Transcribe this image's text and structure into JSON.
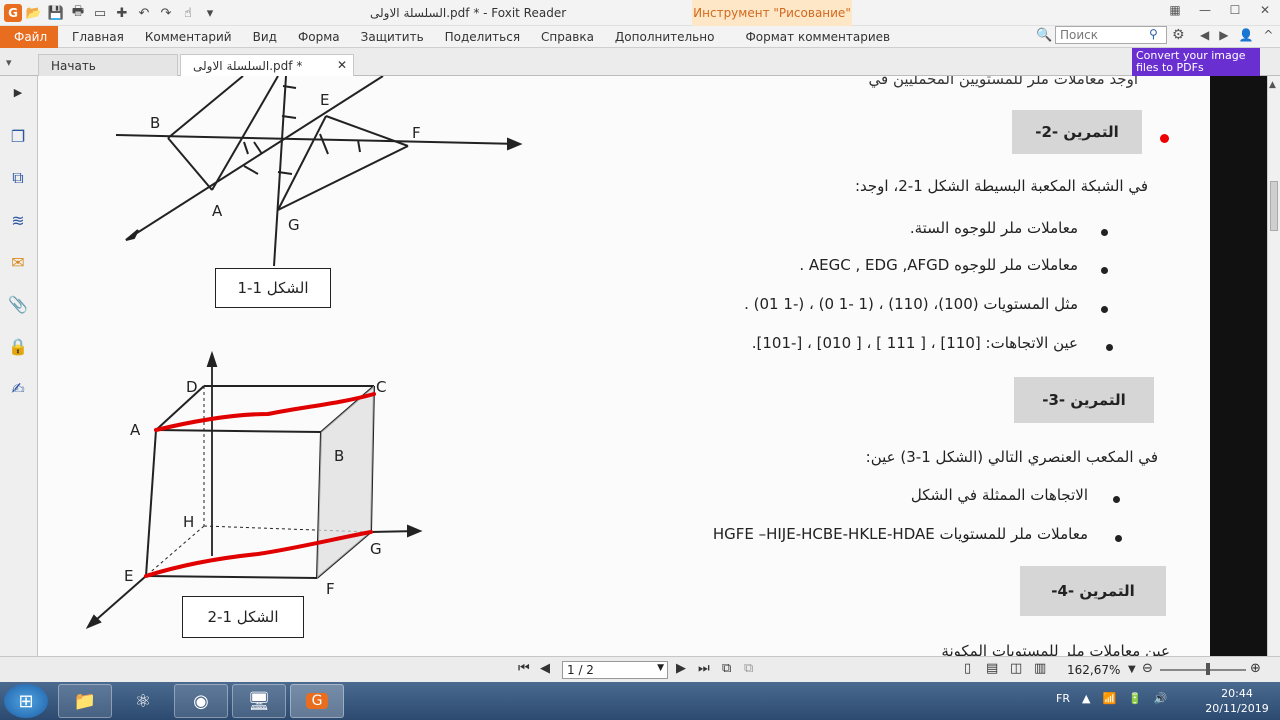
{
  "window": {
    "title": "السلسلة الاولى.pdf * - Foxit Reader",
    "context_tool": "Инструмент \"Рисование\""
  },
  "ribbon": {
    "file_tab": "Файл",
    "tabs": [
      "Главная",
      "Комментарий",
      "Вид",
      "Форма",
      "Защитить",
      "Поделиться",
      "Справка",
      "Дополнительно"
    ],
    "context_tab": "Формат комментариев",
    "search_placeholder": "Поиск"
  },
  "doc_tabs": {
    "start": "Начать",
    "active": "السلسلة الاولى.pdf *"
  },
  "promo": {
    "text": "Convert your image files to PDFs"
  },
  "document": {
    "top_line": "اوجد معاملات ملر للمستويين المحمليين في",
    "ex2": {
      "heading": "التمرين -2-",
      "intro": "في الشبكة المكعبة البسيطة الشكل 1-2، اوجد:",
      "items": [
        "معاملات ملر للوجوه الستة.",
        "معاملات ملر للوجوه AEGC , EDG ,AFGD .",
        "مثل المستويات (100)، (110) ، (1 -1 0) ، (-1 01) .",
        "عين الاتجاهات: [110] ، [ 111 ] ، [ 010] ، [-101]."
      ]
    },
    "ex3": {
      "heading": "التمرين -3-",
      "intro": "في المكعب العنصري التالي (الشكل 1-3) عين:",
      "items": [
        "الاتجاهات الممثلة في الشكل",
        "معاملات ملر للمستويات HGFE –HIJE-HCBE-HKLE-HDAE"
      ]
    },
    "ex4": {
      "heading": "التمرين -4-",
      "cut_line": "عين معاملات ملر للمستويات المكونة"
    },
    "fig1": {
      "label": "الشكل 1-1",
      "points": [
        "B",
        "E",
        "F",
        "A",
        "G"
      ]
    },
    "fig2": {
      "label": "الشكل 1-2",
      "points": [
        "D",
        "C",
        "A",
        "B",
        "H",
        "G",
        "E",
        "F"
      ]
    }
  },
  "statusbar": {
    "page": "1 / 2",
    "zoom": "162,67%"
  },
  "taskbar": {
    "lang": "FR",
    "time": "20:44",
    "date": "20/11/2019"
  },
  "colors": {
    "accent": "#e96d1f",
    "annotation_red": "#e00000"
  }
}
